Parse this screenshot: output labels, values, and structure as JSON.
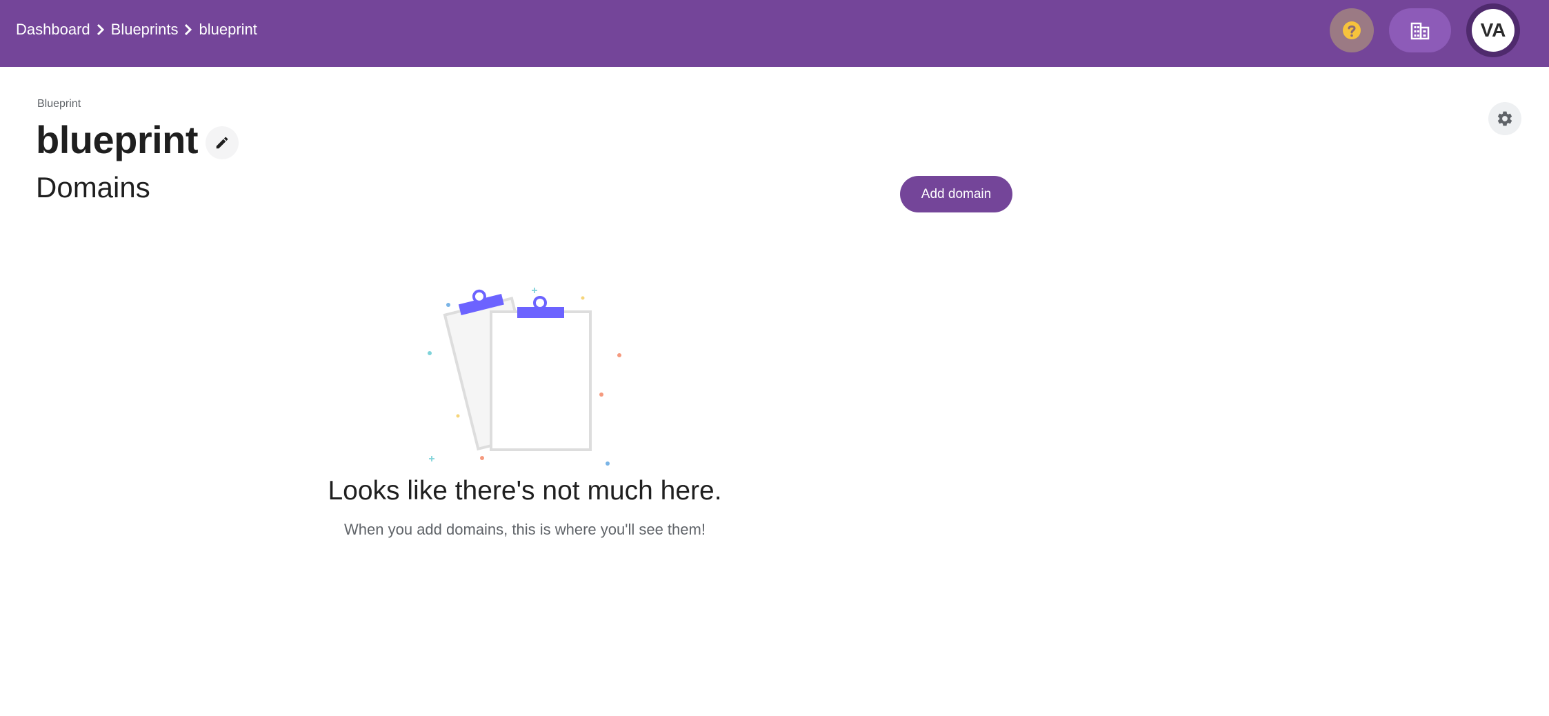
{
  "breadcrumb": {
    "items": [
      {
        "label": "Dashboard"
      },
      {
        "label": "Blueprints"
      },
      {
        "label": "blueprint"
      }
    ]
  },
  "topbar": {
    "help_icon": "help-circle-icon",
    "org_icon": "building-icon",
    "avatar_initials": "VA"
  },
  "header": {
    "overline": "Blueprint",
    "title": "blueprint",
    "edit_icon": "pencil-icon",
    "settings_icon": "gear-icon"
  },
  "domains": {
    "title": "Domains",
    "add_label": "Add domain",
    "empty": {
      "title": "Looks like there's not much here.",
      "subtitle": "When you add domains, this is where you'll see them!"
    }
  },
  "colors": {
    "brand": "#744599",
    "clip_accent": "#6c63ff"
  }
}
